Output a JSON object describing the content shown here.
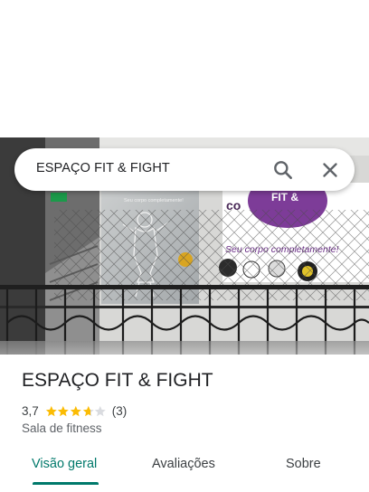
{
  "search": {
    "query": "ESPAÇO FIT & FIGHT",
    "search_icon": "search-icon",
    "close_icon": "close-icon"
  },
  "photo": {
    "wall_text": "Seu corpo completamente!",
    "banner_text": "Seu corpo completamente!"
  },
  "place": {
    "title": "ESPAÇO FIT & FIGHT",
    "rating": "3,7",
    "rating_value": 3.7,
    "stars_max": 5,
    "review_count": "(3)",
    "category": "Sala de fitness",
    "star_color": "#fbbc04",
    "star_empty_color": "#dadce0"
  },
  "tabs": [
    {
      "label": "Visão geral",
      "active": true
    },
    {
      "label": "Avaliações",
      "active": false
    },
    {
      "label": "Sobre",
      "active": false
    }
  ],
  "colors": {
    "accent": "#00796b",
    "text_primary": "#202124",
    "text_secondary": "#5f6368"
  }
}
